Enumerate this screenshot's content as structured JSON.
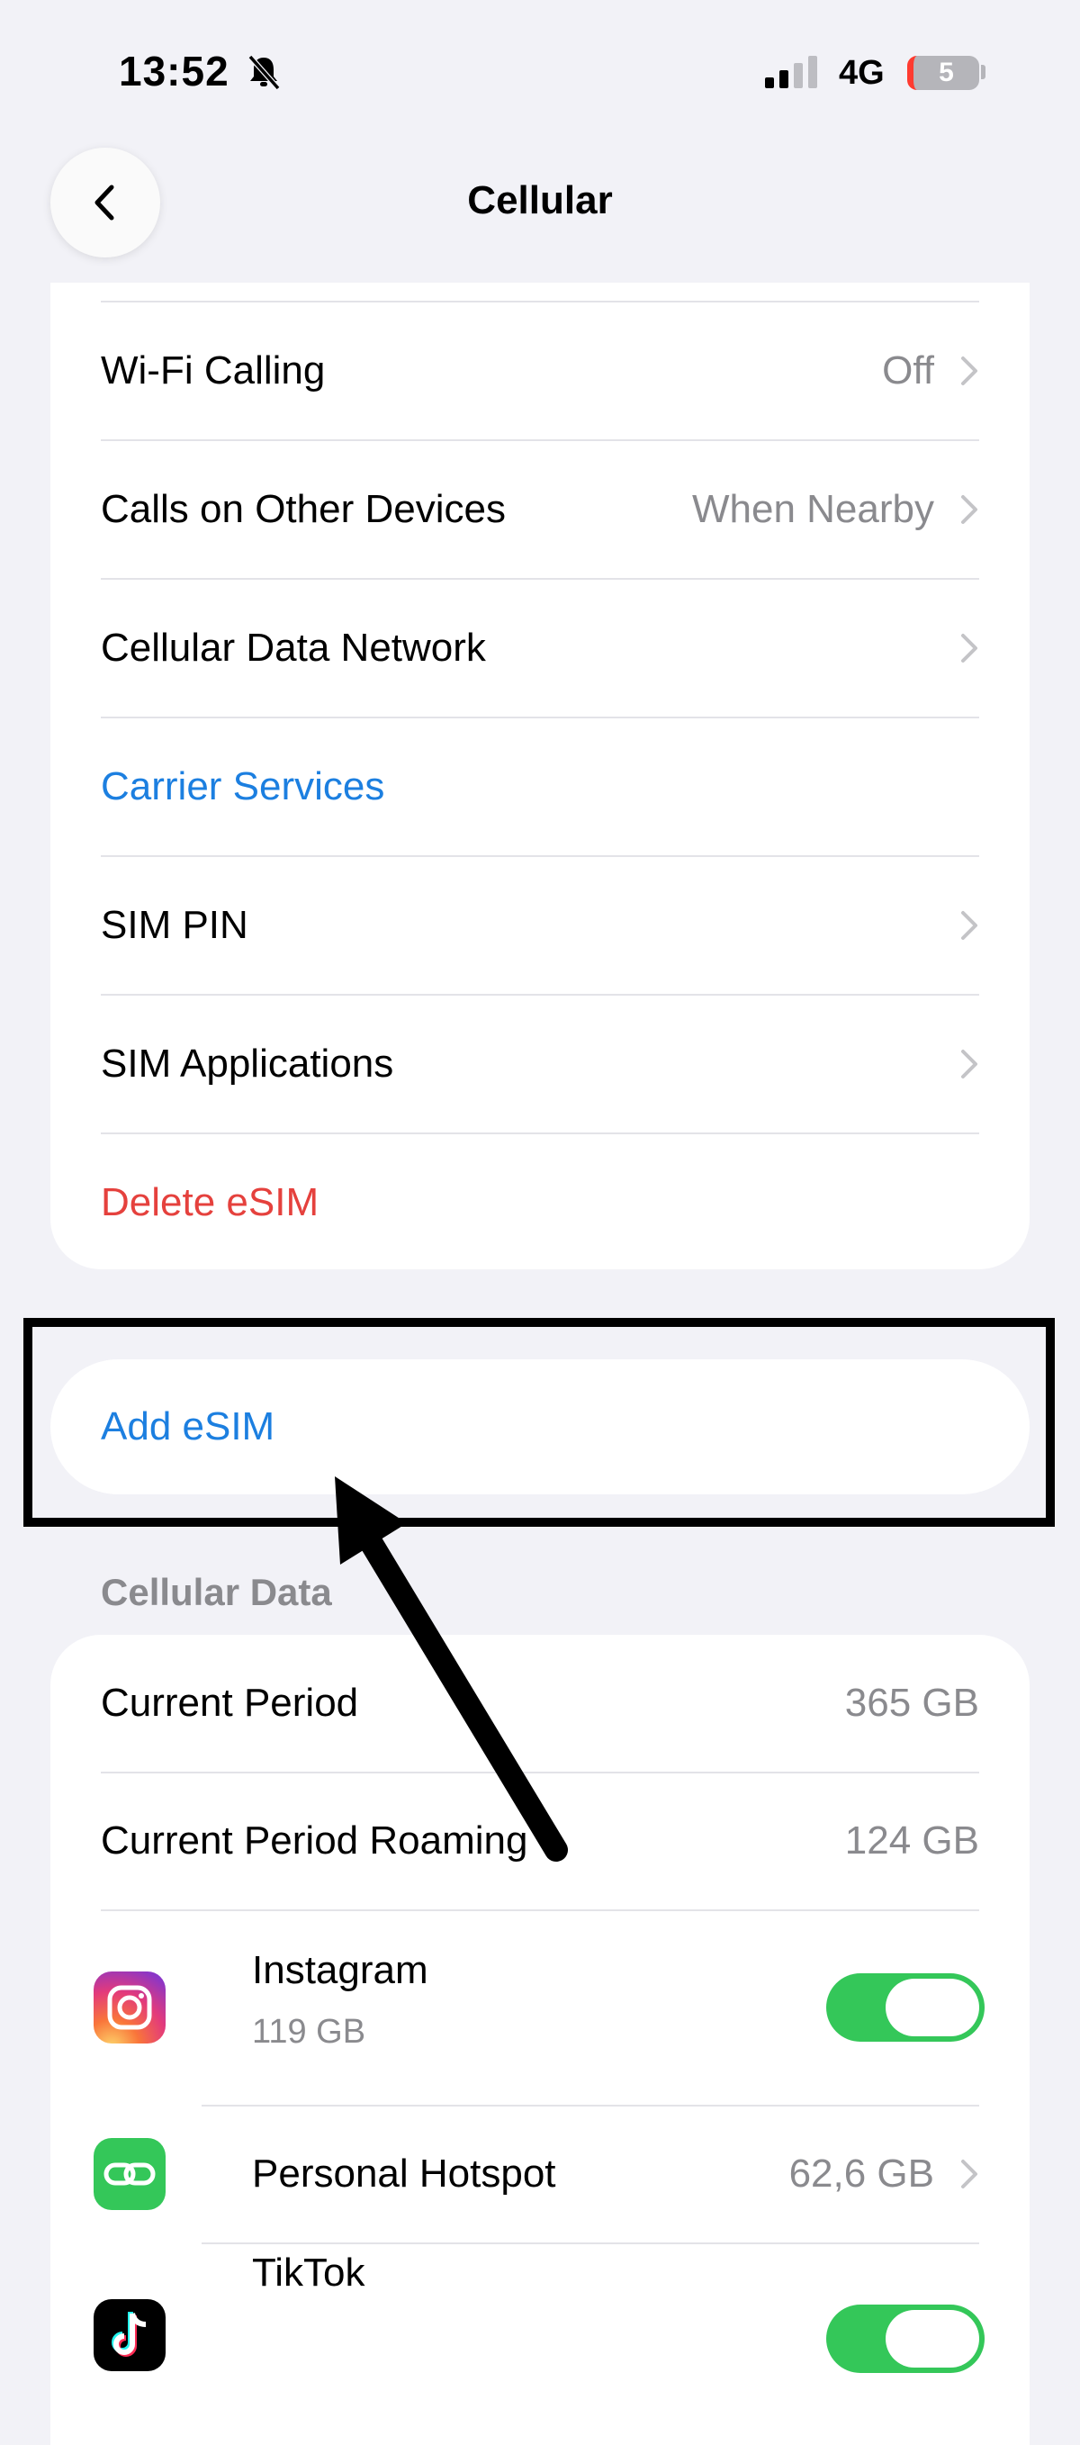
{
  "status_bar": {
    "time": "13:52",
    "network": "4G",
    "battery": "5"
  },
  "nav": {
    "title": "Cellular"
  },
  "settings_rows": [
    {
      "label": "Wi-Fi Calling",
      "value": "Off"
    },
    {
      "label": "Calls on Other Devices",
      "value": "When Nearby"
    },
    {
      "label": "Cellular Data Network",
      "value": ""
    },
    {
      "label": "Carrier Services",
      "value": ""
    },
    {
      "label": "SIM PIN",
      "value": ""
    },
    {
      "label": "SIM Applications",
      "value": ""
    },
    {
      "label": "Delete eSIM",
      "value": ""
    }
  ],
  "add_esim": {
    "label": "Add eSIM"
  },
  "cellular_data": {
    "header": "Cellular Data",
    "current_period": {
      "label": "Current Period",
      "value": "365 GB"
    },
    "current_period_roaming": {
      "label": "Current Period Roaming",
      "value": "124 GB"
    },
    "apps": [
      {
        "name": "Instagram",
        "usage": "119 GB",
        "enabled": true,
        "icon": "instagram-icon"
      },
      {
        "name": "Personal Hotspot",
        "usage": "62,6 GB",
        "icon": "personal-hotspot-icon"
      },
      {
        "name": "TikTok",
        "usage": "",
        "enabled": true,
        "icon": "tiktok-icon"
      }
    ]
  },
  "colors": {
    "accent_blue": "#1c7fe0",
    "destructive_red": "#e5413d",
    "toggle_green": "#34c759"
  }
}
